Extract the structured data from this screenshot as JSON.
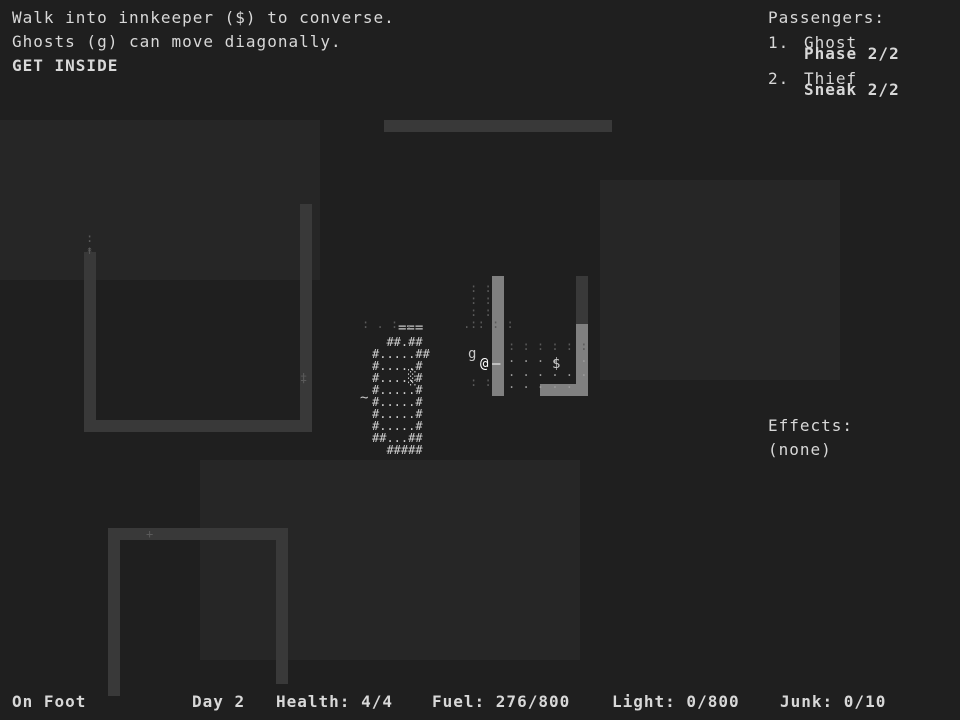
{
  "messages": {
    "line1": "Walk into innkeeper ($) to converse.",
    "line2": "Ghosts (g) can move diagonally.",
    "line3": "GET INSIDE"
  },
  "passengers": {
    "title": "Passengers:",
    "items": [
      {
        "index": "1.",
        "name": "Ghost",
        "ability": "Phase 2/2"
      },
      {
        "index": "2.",
        "name": "Thief",
        "ability": "Sneak 2/2"
      }
    ]
  },
  "effects": {
    "title": "Effects:",
    "value": "(none)"
  },
  "status": {
    "mode": "On Foot",
    "day": "Day 2",
    "health": "Health: 4/4",
    "fuel": "Fuel: 276/800",
    "light": "Light: 0/800",
    "junk": "Junk: 0/10"
  },
  "map": {
    "player": "@",
    "ghost": "g",
    "innkeeper": "$",
    "door": "=",
    "roof": "===",
    "water": "~",
    "campfire": "░",
    "house_wall": "#",
    "floor": "."
  }
}
